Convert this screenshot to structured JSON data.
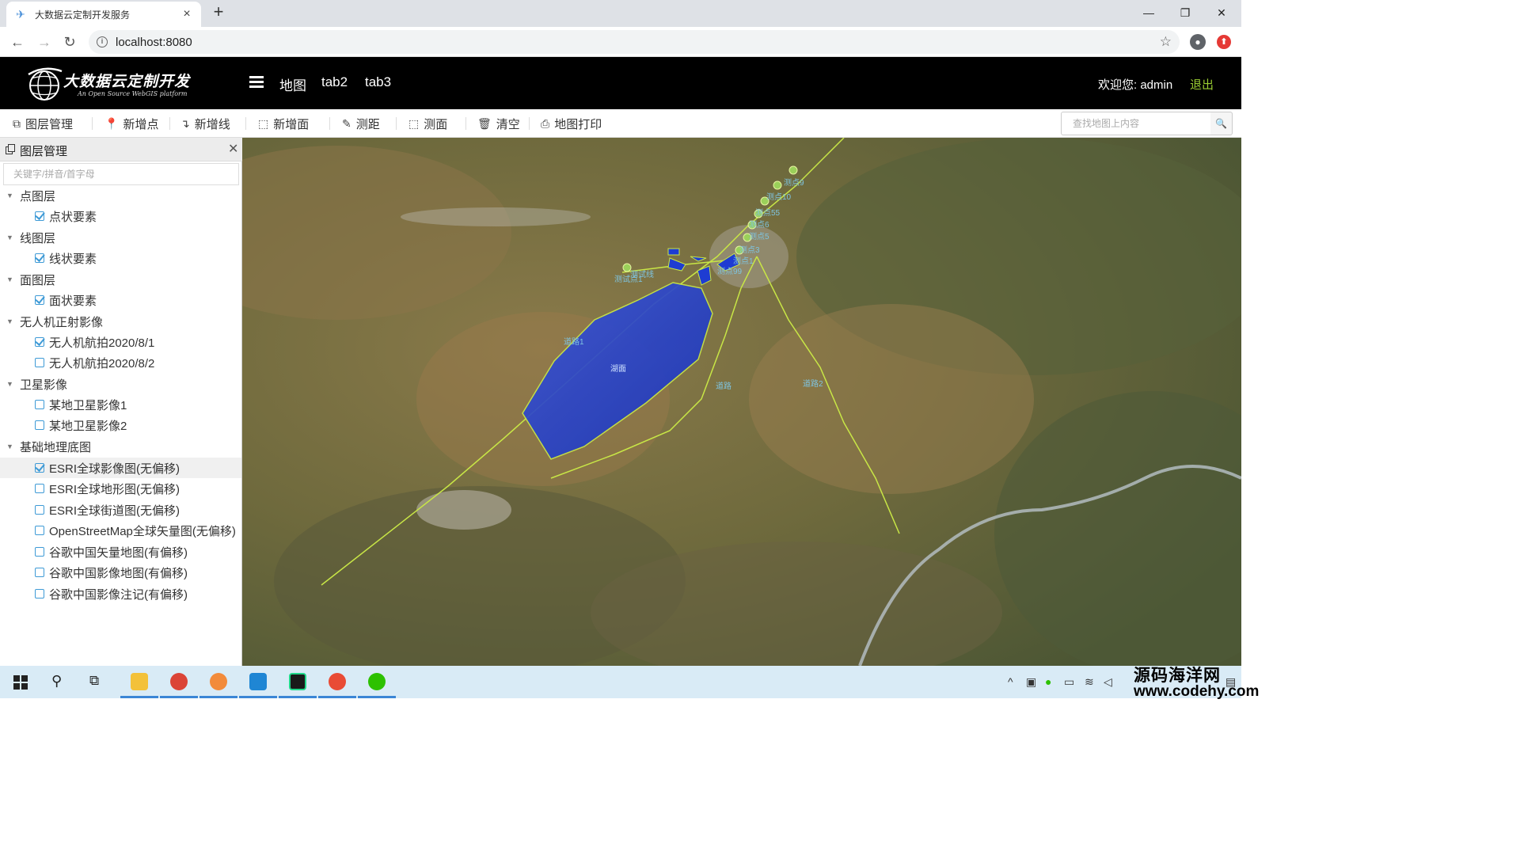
{
  "browser": {
    "tab_title": "大数据云定制开发服务",
    "url": "localhost:8080"
  },
  "header": {
    "logo_title": "大数据云定制开发",
    "logo_subtitle": "An Open Source WebGIS platform",
    "nav": [
      "地图",
      "tab2",
      "tab3"
    ],
    "welcome": "欢迎您: admin",
    "logout": "退出"
  },
  "toolbar": {
    "layers": "图层管理",
    "add_point": "新增点",
    "add_line": "新增线",
    "add_polygon": "新增面",
    "measure_distance": "测距",
    "measure_area": "测面",
    "clear": "清空",
    "print": "地图打印",
    "search_placeholder": "查找地图上内容"
  },
  "sidebar": {
    "title": "图层管理",
    "filter_placeholder": "关键字/拼音/首字母",
    "groups": [
      {
        "label": "点图层",
        "items": [
          {
            "label": "点状要素",
            "checked": true
          }
        ]
      },
      {
        "label": "线图层",
        "items": [
          {
            "label": "线状要素",
            "checked": true
          }
        ]
      },
      {
        "label": "面图层",
        "items": [
          {
            "label": "面状要素",
            "checked": true
          }
        ]
      },
      {
        "label": "无人机正射影像",
        "items": [
          {
            "label": "无人机航拍2020/8/1",
            "checked": true
          },
          {
            "label": "无人机航拍2020/8/2",
            "checked": false
          }
        ]
      },
      {
        "label": "卫星影像",
        "items": [
          {
            "label": "某地卫星影像1",
            "checked": false
          },
          {
            "label": "某地卫星影像2",
            "checked": false
          }
        ]
      },
      {
        "label": "基础地理底图",
        "items": [
          {
            "label": "ESRI全球影像图(无偏移)",
            "checked": true
          },
          {
            "label": "ESRI全球地形图(无偏移)",
            "checked": false
          },
          {
            "label": "ESRI全球街道图(无偏移)",
            "checked": false
          },
          {
            "label": "OpenStreetMap全球矢量图(无偏移)",
            "checked": false
          },
          {
            "label": "谷歌中国矢量地图(有偏移)",
            "checked": false
          },
          {
            "label": "谷歌中国影像地图(有偏移)",
            "checked": false
          },
          {
            "label": "谷歌中国影像注记(有偏移)",
            "checked": false
          }
        ]
      }
    ]
  },
  "map": {
    "lake_label": "湖面",
    "road_labels": [
      "道路1",
      "道路",
      "道路2"
    ],
    "line_label": "测试线",
    "point_labels": [
      "测试点1",
      "测点9",
      "测点10",
      "测点55",
      "测点6",
      "测点5",
      "测点3",
      "测点1",
      "测点99"
    ]
  },
  "watermark": {
    "line1": "源码海洋网",
    "line2": "www.codehy.com"
  },
  "colors": {
    "header_bg": "#000000",
    "logout": "#9acd32",
    "checkbox": "#3e9ad6",
    "lake_fill": "#1e3cd2",
    "feature_line": "#c8e646"
  }
}
